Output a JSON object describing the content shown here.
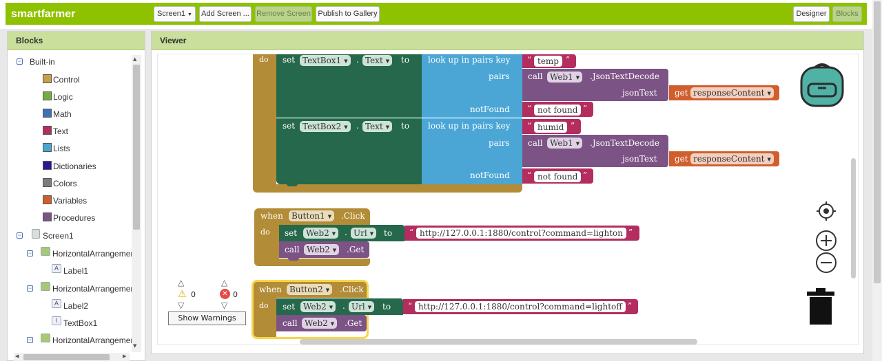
{
  "app": {
    "name": "smartfarmer"
  },
  "toolbar": {
    "screen_select": "Screen1",
    "add_screen": "Add Screen ...",
    "remove_screen": "Remove Screen",
    "publish": "Publish to Gallery",
    "designer": "Designer",
    "blocks": "Blocks"
  },
  "panels": {
    "blocks_title": "Blocks",
    "viewer_title": "Viewer"
  },
  "tree": {
    "builtin": "Built-in",
    "builtin_items": [
      {
        "label": "Control",
        "color": "#c8a047"
      },
      {
        "label": "Logic",
        "color": "#77ab41"
      },
      {
        "label": "Math",
        "color": "#3f71b5"
      },
      {
        "label": "Text",
        "color": "#b32d5e"
      },
      {
        "label": "Lists",
        "color": "#49a6d4"
      },
      {
        "label": "Dictionaries",
        "color": "#2d1799"
      },
      {
        "label": "Colors",
        "color": "#7d7d7d"
      },
      {
        "label": "Variables",
        "color": "#d05f2d"
      },
      {
        "label": "Procedures",
        "color": "#7c5385"
      }
    ],
    "screen1": "Screen1",
    "components": [
      "HorizontalArrangemen",
      "Label1",
      "HorizontalArrangemen",
      "Label2",
      "TextBox1",
      "HorizontalArrangemen"
    ]
  },
  "blocks": {
    "do": "do",
    "set": "set",
    "to": "to",
    "dot": ".",
    "when": "when",
    "call": "call",
    "get": "get",
    "lookup": "look up in pairs  key",
    "pairs": "pairs",
    "notfound": "notFound",
    "jsontext": "jsonText",
    "json_decode": ".JsonTextDecode",
    "click": ".Click",
    "url_prop": "Url",
    "get_method": ".Get",
    "text_prop": "Text",
    "quote_open": "“",
    "quote_close": "”",
    "textbox1": "TextBox1",
    "textbox2": "TextBox2",
    "web1": "Web1",
    "web2": "Web2",
    "button1": "Button1",
    "button2": "Button2",
    "key_temp": "temp",
    "key_humid": "humid",
    "not_found_str": "not found",
    "response_content": "responseContent",
    "url_on": "http://127.0.0.1:1880/control?command=lighton",
    "url_off": "http://127.0.0.1:1880/control?command=lightoff"
  },
  "warnings": {
    "warn_count": "0",
    "error_count": "0",
    "show_warnings": "Show Warnings"
  },
  "icons": [
    "backpack-icon",
    "target-icon",
    "zoom-in-icon",
    "zoom-out-icon",
    "trash-icon",
    "warning-icon",
    "error-icon"
  ]
}
